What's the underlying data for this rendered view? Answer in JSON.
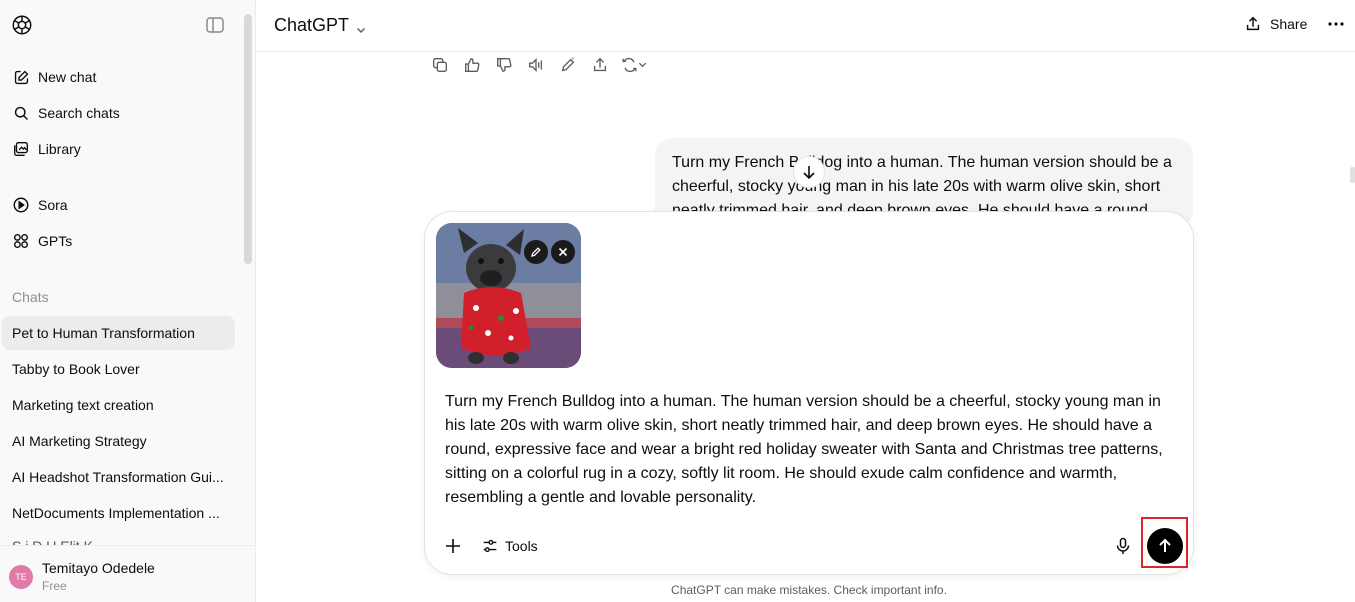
{
  "sidebar": {
    "nav": [
      {
        "label": "New chat",
        "icon": "new-chat-icon"
      },
      {
        "label": "Search chats",
        "icon": "search-icon"
      },
      {
        "label": "Library",
        "icon": "library-icon"
      },
      {
        "label": "Sora",
        "icon": "play-icon"
      },
      {
        "label": "GPTs",
        "icon": "grid-icon"
      }
    ],
    "section_label": "Chats",
    "history": [
      "Pet to Human Transformation",
      "Tabby to Book Lover",
      "Marketing text creation",
      "AI Marketing Strategy",
      "AI Headshot Transformation Gui...",
      "NetDocuments Implementation ...",
      "S   i D   U Elit   K"
    ],
    "user": {
      "initials": "TE",
      "name": "Temitayo Odedele",
      "plan": "Free"
    }
  },
  "header": {
    "model": "ChatGPT",
    "share_label": "Share"
  },
  "message": {
    "text": "Turn my French Bulldog into a human. The human version should be a cheerful, stocky young man in his late 20s with warm olive skin, short neatly trimmed hair, and deep brown eyes. He should have a round,"
  },
  "composer": {
    "prompt": "Turn my French Bulldog into a human. The human version should be a cheerful, stocky young man in his late 20s with warm olive skin, short neatly trimmed hair, and deep brown eyes. He should have a round, expressive face and wear a bright red holiday sweater with Santa and Christmas tree patterns, sitting on a colorful rug in a cozy, softly lit room. He should exude calm confidence and warmth, resembling a gentle and lovable personality.",
    "tools_label": "Tools"
  },
  "disclaimer": "ChatGPT can make mistakes. Check important info.",
  "colors": {
    "accent": "#000000",
    "highlight": "#d9262c",
    "sidebar_bg": "#f9f9f9",
    "bubble_bg": "#f4f4f4"
  }
}
